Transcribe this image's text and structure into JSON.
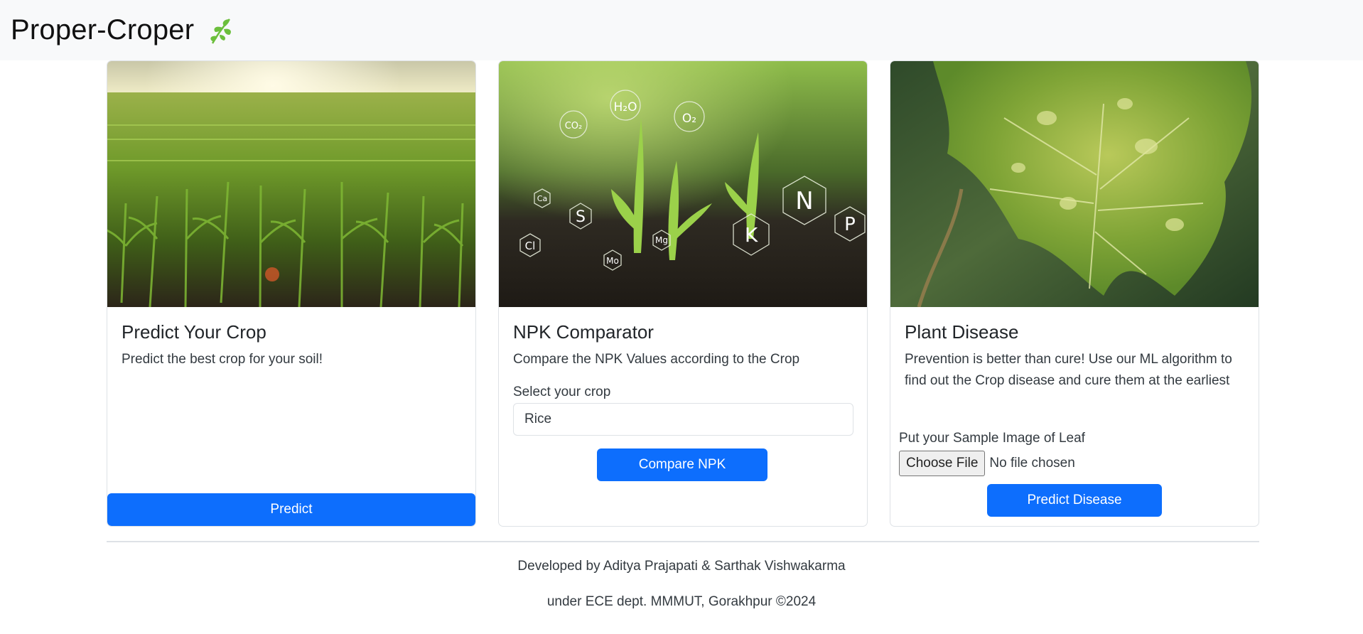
{
  "navbar": {
    "brand": "Proper-Croper",
    "brand_icon": "leaf-sprig-icon",
    "background": "#f8f9fa"
  },
  "cards": {
    "crop": {
      "image_icon": "cornfield-photo",
      "title": "Predict Your Crop",
      "text": "Predict the best crop for your soil!",
      "button": "Predict"
    },
    "npk": {
      "image_icon": "seedlings-nutrients-photo",
      "title": "NPK Comparator",
      "text": "Compare the NPK Values according to the Crop",
      "select_label": "Select your crop",
      "select_value": "Rice",
      "button": "Compare NPK",
      "image_labels": {
        "h2o": "H₂O",
        "o2": "O₂",
        "co2": "CO₂",
        "ca": "Ca",
        "s": "S",
        "cl": "Cl",
        "mo": "Mo",
        "mg": "Mg",
        "k": "K",
        "n": "N",
        "p": "P"
      }
    },
    "disease": {
      "image_icon": "diseased-leaf-photo",
      "title": "Plant Disease",
      "text": "Prevention is better than cure! Use our ML algorithm to find out the Crop disease and cure them at the earliest",
      "file_label": "Put your Sample Image of Leaf",
      "file_button": "Choose File",
      "file_status": "No file chosen",
      "button": "Predict Disease"
    }
  },
  "footer": {
    "line1": "Developed by Aditya Prajapati & Sarthak Vishwakarma",
    "line2": "under ECE dept. MMMUT, Gorakhpur ©2024"
  },
  "colors": {
    "primary": "#0d6efd",
    "border": "#dee2e6"
  }
}
